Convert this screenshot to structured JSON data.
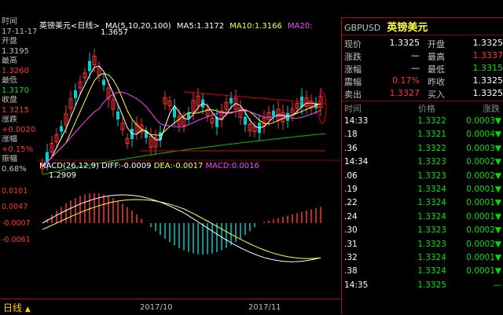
{
  "header": {
    "chart_label": "英镑美元<日线>",
    "ma_label": "MA(5,10,20,100)",
    "ma5": "MA5:1.3172",
    "ma10": "MA10:1.3166",
    "ma20": "MA20:"
  },
  "left_info": [
    {
      "label": "时间",
      "value": "17-11-17",
      "value_color": "#c0c0c0"
    },
    {
      "label": "开盘",
      "value": "1.3195",
      "value_color": "#c0c0c0"
    },
    {
      "label": "最高",
      "value": "1.3260",
      "value_color": "#ff3333"
    },
    {
      "label": "最低",
      "value": "1.3170",
      "value_color": "#00e000"
    },
    {
      "label": "收盘",
      "value": "1.3215",
      "value_color": "#ff3333"
    },
    {
      "label": "涨跌",
      "value": "+0.0020",
      "value_color": "#ff3333"
    },
    {
      "label": "涨幅",
      "value": "+0.15%",
      "value_color": "#ff3333"
    },
    {
      "label": "振幅",
      "value": "0.68%",
      "value_color": "#c0c0c0"
    }
  ],
  "price_annotations": {
    "high": "1.3657",
    "low": "1.2909"
  },
  "macd": {
    "label": "MACD(26,12,9)",
    "diff": "DIFF:-0.0009",
    "dea": "DEA:-0.0017",
    "macd": "MACD:0.0016",
    "axis_ticks": [
      "0.0101",
      "0.0047",
      "-0.0007",
      "-0.0061"
    ]
  },
  "bottom": {
    "period": "日线",
    "period_arrow": "▲",
    "x_ticks": [
      "2017/10",
      "2017/11"
    ]
  },
  "quote": {
    "code": "GBPUSD",
    "name": "英镑美元",
    "rows": [
      {
        "l1": "现价",
        "v1": "1.3325",
        "c1": "#ffffff",
        "l2": "开盘",
        "v2": "1.3325",
        "c2": "#ffffff"
      },
      {
        "l1": "涨跌",
        "v1": "—",
        "c1": "#ffffff",
        "l2": "最高",
        "v2": "1.3337",
        "c2": "#ff3333"
      },
      {
        "l1": "涨幅",
        "v1": "—",
        "c1": "#ffffff",
        "l2": "最低",
        "v2": "1.3315",
        "c2": "#00e000"
      },
      {
        "l1": "震幅",
        "v1": "0.17%",
        "c1": "#ff3333",
        "l2": "昨收",
        "v2": "1.3325",
        "c2": "#ffffff"
      },
      {
        "l1": "卖出",
        "v1": "1.3327",
        "c1": "#ff3333",
        "l2": "买入",
        "v2": "1.3325",
        "c2": "#ffffff"
      }
    ]
  },
  "ticks_header": {
    "time": "时间",
    "price": "价格",
    "change": "涨跌"
  },
  "ticks": [
    {
      "time": "14:33",
      "price": "1.3322",
      "change": "0.0003▼"
    },
    {
      "time": ".18",
      "price": "1.3321",
      "change": "0.0004▼"
    },
    {
      "time": ".36",
      "price": "1.3322",
      "change": "0.0003▼"
    },
    {
      "time": "14:34",
      "price": "1.3323",
      "change": "0.0002▼"
    },
    {
      "time": ".06",
      "price": "1.3323",
      "change": "0.0002▼"
    },
    {
      "time": ".19",
      "price": "1.3324",
      "change": "0.0001▼"
    },
    {
      "time": ".22",
      "price": "1.3324",
      "change": "0.0001▼"
    },
    {
      "time": ".24",
      "price": "1.3324",
      "change": "0.0001▼"
    },
    {
      "time": ".30",
      "price": "1.3323",
      "change": "0.0002▼"
    },
    {
      "time": ".31",
      "price": "1.3323",
      "change": "0.0002▼"
    },
    {
      "time": ".32",
      "price": "1.3324",
      "change": "0.0001▼"
    },
    {
      "time": ".38",
      "price": "1.3324",
      "change": "0.0001▼"
    },
    {
      "time": "14:35",
      "price": "1.3325",
      "change": "—"
    }
  ]
}
